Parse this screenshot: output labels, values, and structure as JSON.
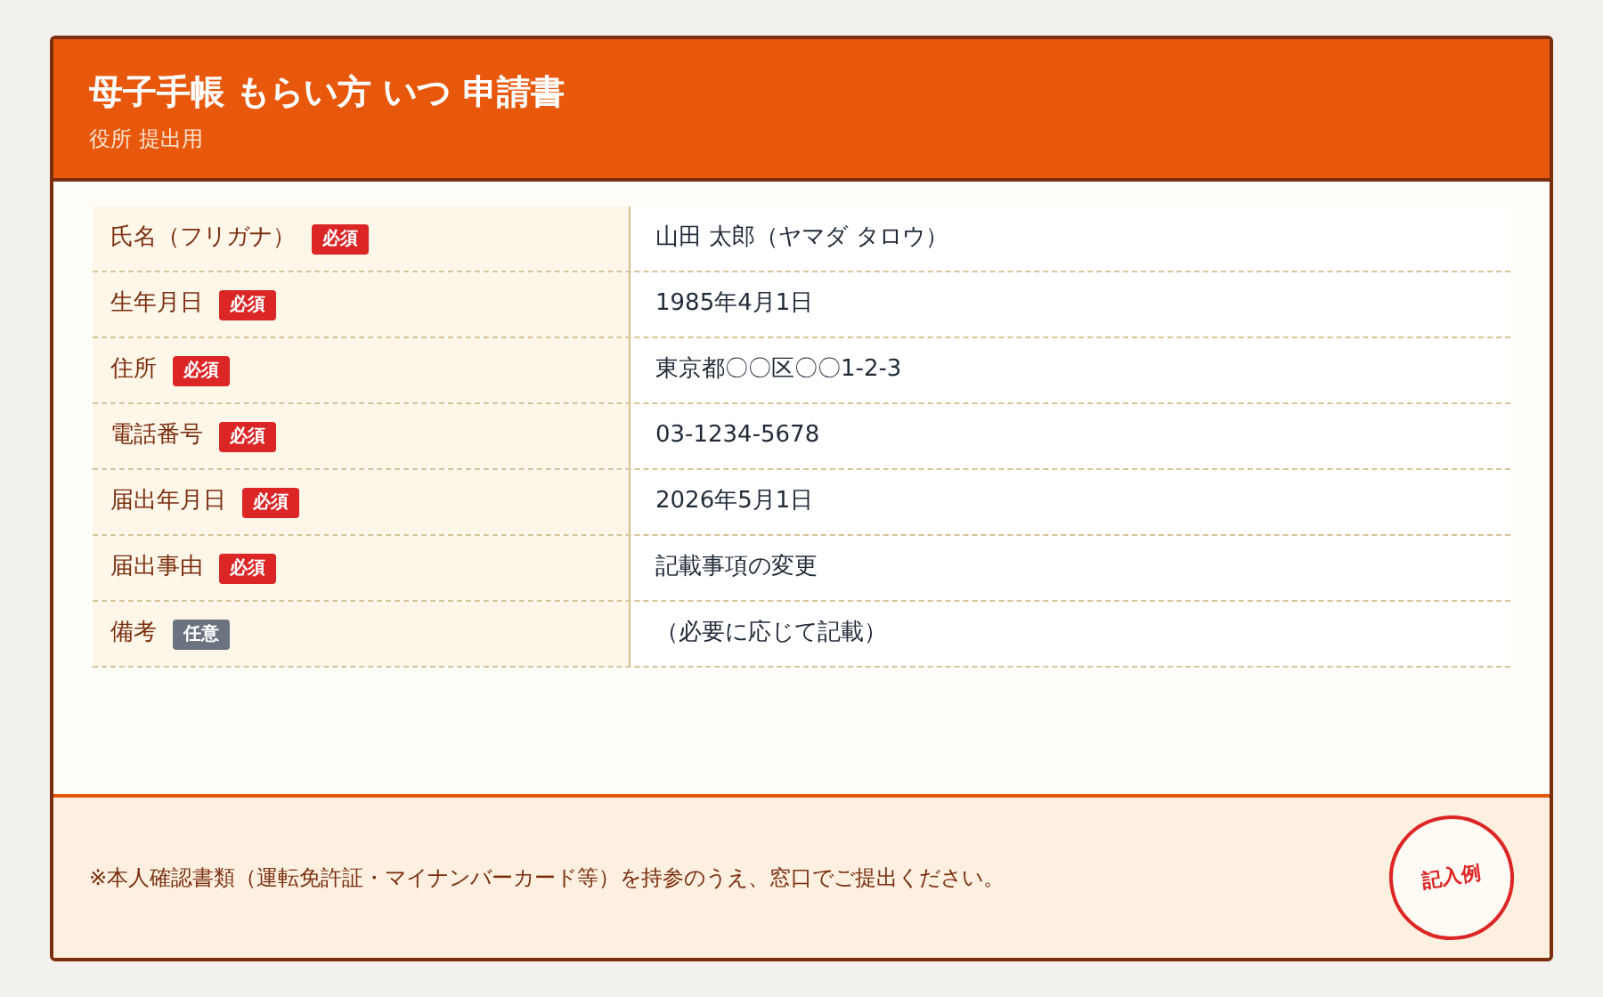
{
  "header": {
    "title": "母子手帳 もらい方 いつ 申請書",
    "subtitle": "役所 提出用"
  },
  "rows": [
    {
      "label": "氏名（フリガナ）",
      "badge": {
        "text": "必須",
        "kind": "required"
      },
      "value": "山田 太郎（ヤマダ タロウ）"
    },
    {
      "label": "生年月日",
      "badge": {
        "text": "必須",
        "kind": "required"
      },
      "value": "1985年4月1日"
    },
    {
      "label": "住所",
      "badge": {
        "text": "必須",
        "kind": "required"
      },
      "value": "東京都〇〇区〇〇1-2-3"
    },
    {
      "label": "電話番号",
      "badge": {
        "text": "必須",
        "kind": "required"
      },
      "value": "03-1234-5678"
    },
    {
      "label": "届出年月日",
      "badge": {
        "text": "必須",
        "kind": "required"
      },
      "value": "2026年5月1日"
    },
    {
      "label": "届出事由",
      "badge": {
        "text": "必須",
        "kind": "required"
      },
      "value": "記載事項の変更"
    },
    {
      "label": "備考",
      "badge": {
        "text": "任意",
        "kind": "optional"
      },
      "value": "（必要に応じて記載）"
    }
  ],
  "footer": {
    "note": "※本人確認書類（運転免許証・マイナンバーカード等）を持参のうえ、窓口でご提出ください。",
    "stamp": "記入例"
  }
}
